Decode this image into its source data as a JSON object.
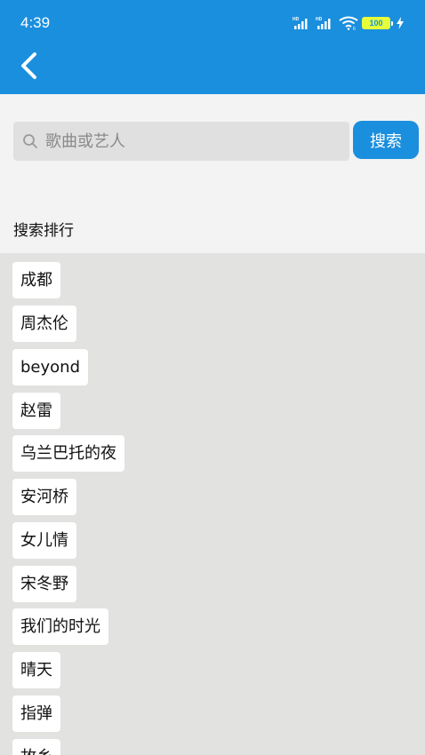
{
  "status_bar": {
    "time": "4:39",
    "battery": "100",
    "icons": [
      "hd-signal-icon",
      "hd-signal-icon",
      "wifi-icon",
      "battery-icon",
      "charging-icon"
    ]
  },
  "header": {
    "back_icon": "chevron-left-icon"
  },
  "search": {
    "placeholder": "歌曲或艺人",
    "value": "",
    "button_label": "搜索",
    "icon": "search-icon"
  },
  "ranking": {
    "title": "搜索排行",
    "items": [
      "成都",
      "周杰伦",
      "beyond",
      "赵雷",
      "乌兰巴托的夜",
      "安河桥",
      "女儿情",
      "宋冬野",
      "我们的时光",
      "晴天",
      "指弹",
      "故乡"
    ]
  },
  "colors": {
    "accent": "#1a8fde",
    "page_bg": "#e2e2e0",
    "search_area_bg": "#f3f3f3",
    "input_bg": "#e0e0e0"
  }
}
